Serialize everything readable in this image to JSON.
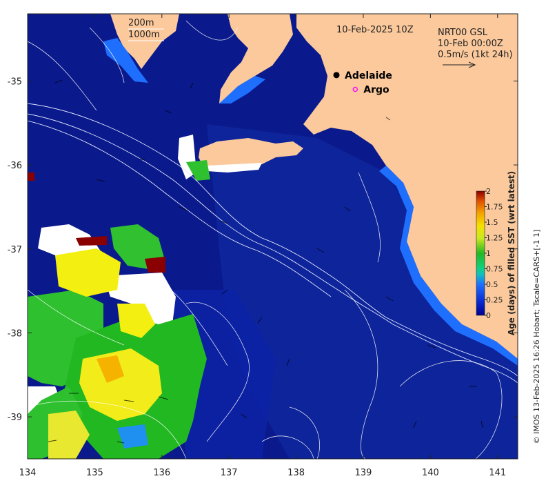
{
  "map": {
    "x_ticks": [
      "134",
      "135",
      "136",
      "137",
      "138",
      "139",
      "140",
      "141"
    ],
    "y_ticks": [
      "-35",
      "-36",
      "-37",
      "-38",
      "-39"
    ],
    "x_range": [
      134,
      141.3
    ],
    "y_range": [
      -39.5,
      -34.2
    ]
  },
  "legend": {
    "isobath_200": "200m",
    "isobath_1000": "1000m"
  },
  "title": {
    "datetime": "10-Feb-2025 10Z"
  },
  "current_info": {
    "line1": "NRT00 GSL",
    "line2": "10-Feb 00:00Z",
    "line3": "0.5m/s (1kt 24h)"
  },
  "places": [
    {
      "label": "Adelaide",
      "lon": 138.6,
      "lat": -34.93,
      "marker": "filled-circle"
    },
    {
      "label": "Argo",
      "lon": 138.88,
      "lat": -35.1,
      "marker": "magenta-ring"
    }
  ],
  "colorbar": {
    "label": "Age (days) of filled SST (wrt latest)",
    "ticks": [
      "0",
      "0.25",
      "0.5",
      "0.75",
      "1",
      "1.25",
      "1.5",
      "1.75",
      "2"
    ],
    "range": [
      0,
      2
    ]
  },
  "credit": "© IMOS 13-Feb-2025 16:26 Hobart; Tscale=CARS+[-1 1]",
  "colors": {
    "ocean": "#0a1a8c",
    "land": "#fbc99c",
    "coast_blue": "#1f6fff",
    "patch_green": "#2ec02e",
    "patch_yellow": "#f3ef10"
  }
}
